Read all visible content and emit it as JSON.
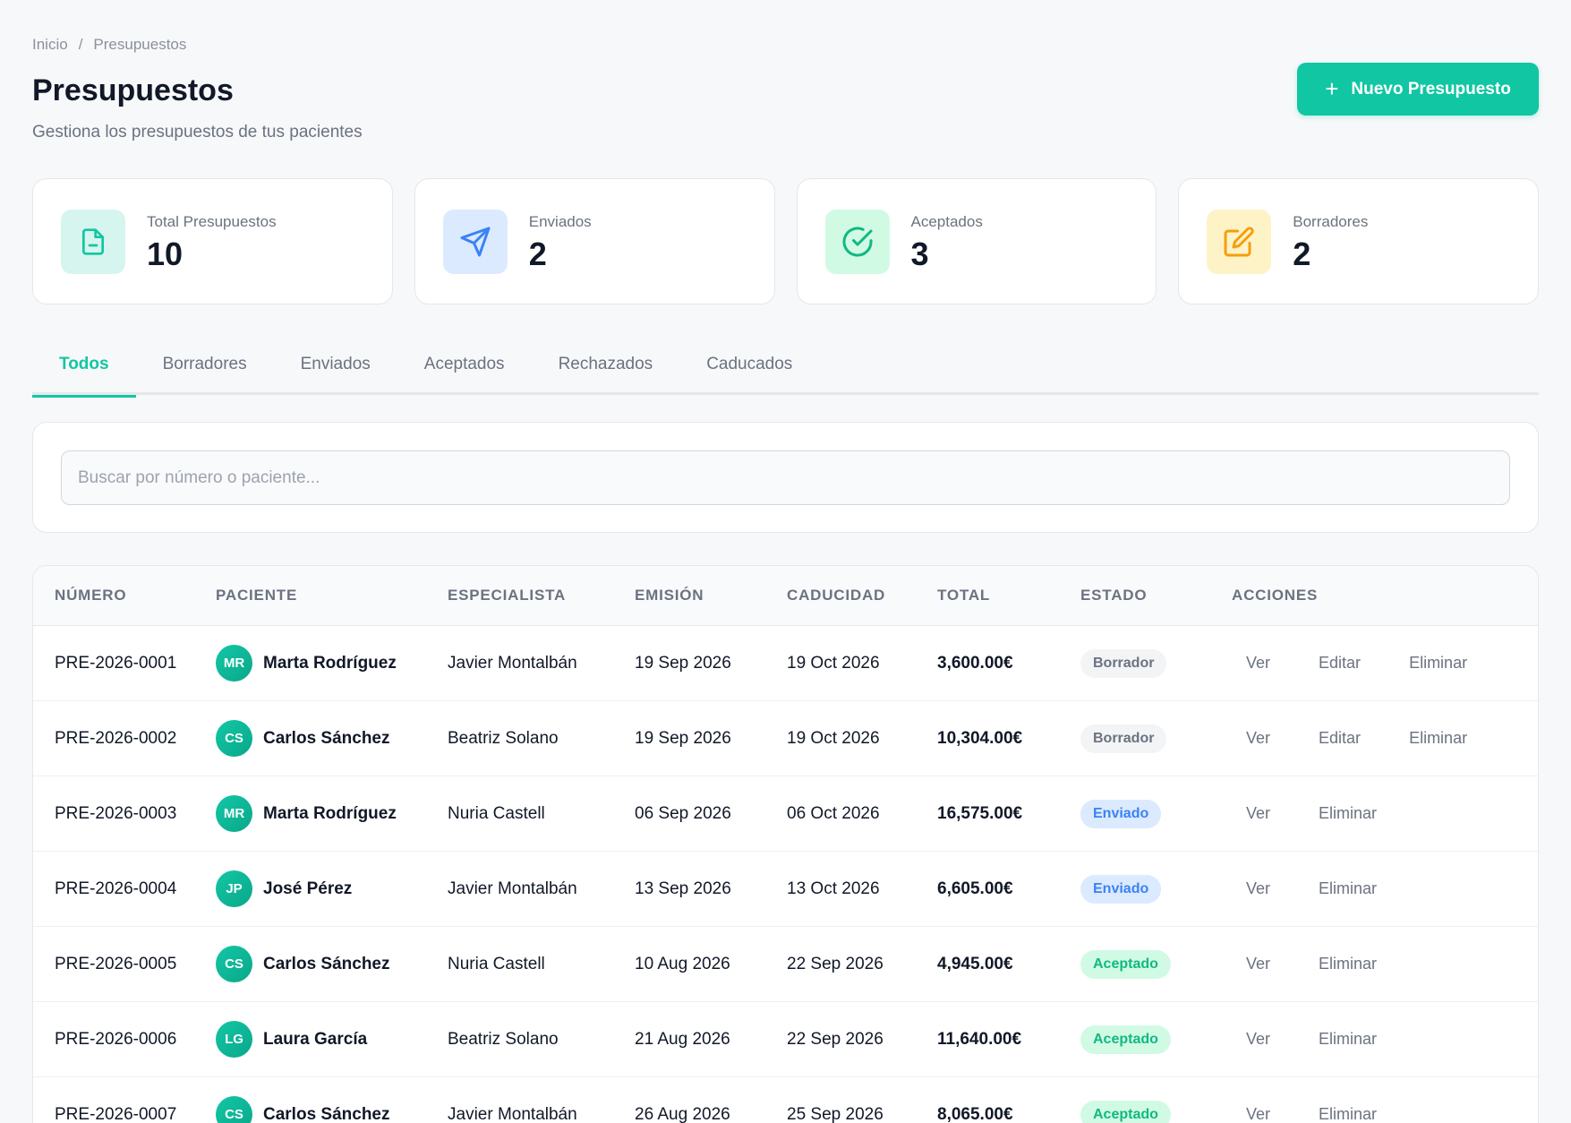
{
  "breadcrumb": {
    "home": "Inicio",
    "separator": "/",
    "current": "Presupuestos"
  },
  "header": {
    "title": "Presupuestos",
    "subtitle": "Gestiona los presupuestos de tus pacientes",
    "new_button": {
      "icon": "plus-icon",
      "label": "Nuevo Presupuesto"
    }
  },
  "stats": [
    {
      "label": "Total Presupuestos",
      "value": "10",
      "icon": "file-icon",
      "color": "#11c6a3",
      "bg": "#d5f5ee"
    },
    {
      "label": "Enviados",
      "value": "2",
      "icon": "send-icon",
      "color": "#3b82f6",
      "bg": "#dbeafe"
    },
    {
      "label": "Aceptados",
      "value": "3",
      "icon": "check-circle-icon",
      "color": "#10b981",
      "bg": "#d1fae5"
    },
    {
      "label": "Borradores",
      "value": "2",
      "icon": "edit-icon",
      "color": "#f59e0b",
      "bg": "#fef3c7"
    }
  ],
  "tabs": [
    {
      "label": "Todos",
      "active": true
    },
    {
      "label": "Borradores",
      "active": false
    },
    {
      "label": "Enviados",
      "active": false
    },
    {
      "label": "Aceptados",
      "active": false
    },
    {
      "label": "Rechazados",
      "active": false
    },
    {
      "label": "Caducados",
      "active": false
    }
  ],
  "search": {
    "placeholder": "Buscar por número o paciente...",
    "value": ""
  },
  "table": {
    "columns": [
      "NÚMERO",
      "PACIENTE",
      "ESPECIALISTA",
      "EMISIÓN",
      "CADUCIDAD",
      "TOTAL",
      "ESTADO",
      "ACCIONES"
    ],
    "rows": [
      {
        "numero": "PRE-2026-0001",
        "initials": "MR",
        "paciente": "Marta Rodríguez",
        "especialista": "Javier Montalbán",
        "emision": "19 Sep 2026",
        "caducidad": "19 Oct 2026",
        "total": "3,600.00€",
        "estado": "Borrador",
        "estado_key": "borrador",
        "acciones": [
          "Ver",
          "Editar",
          "Eliminar"
        ]
      },
      {
        "numero": "PRE-2026-0002",
        "initials": "CS",
        "paciente": "Carlos Sánchez",
        "especialista": "Beatriz Solano",
        "emision": "19 Sep 2026",
        "caducidad": "19 Oct 2026",
        "total": "10,304.00€",
        "estado": "Borrador",
        "estado_key": "borrador",
        "acciones": [
          "Ver",
          "Editar",
          "Eliminar"
        ]
      },
      {
        "numero": "PRE-2026-0003",
        "initials": "MR",
        "paciente": "Marta Rodríguez",
        "especialista": "Nuria Castell",
        "emision": "06 Sep 2026",
        "caducidad": "06 Oct 2026",
        "total": "16,575.00€",
        "estado": "Enviado",
        "estado_key": "enviado",
        "acciones": [
          "Ver",
          "Eliminar"
        ]
      },
      {
        "numero": "PRE-2026-0004",
        "initials": "JP",
        "paciente": "José Pérez",
        "especialista": "Javier Montalbán",
        "emision": "13 Sep 2026",
        "caducidad": "13 Oct 2026",
        "total": "6,605.00€",
        "estado": "Enviado",
        "estado_key": "enviado",
        "acciones": [
          "Ver",
          "Eliminar"
        ]
      },
      {
        "numero": "PRE-2026-0005",
        "initials": "CS",
        "paciente": "Carlos Sánchez",
        "especialista": "Nuria Castell",
        "emision": "10 Aug 2026",
        "caducidad": "22 Sep 2026",
        "total": "4,945.00€",
        "estado": "Aceptado",
        "estado_key": "aceptado",
        "acciones": [
          "Ver",
          "Eliminar"
        ]
      },
      {
        "numero": "PRE-2026-0006",
        "initials": "LG",
        "paciente": "Laura García",
        "especialista": "Beatriz Solano",
        "emision": "21 Aug 2026",
        "caducidad": "22 Sep 2026",
        "total": "11,640.00€",
        "estado": "Aceptado",
        "estado_key": "aceptado",
        "acciones": [
          "Ver",
          "Eliminar"
        ]
      },
      {
        "numero": "PRE-2026-0007",
        "initials": "CS",
        "paciente": "Carlos Sánchez",
        "especialista": "Javier Montalbán",
        "emision": "26 Aug 2026",
        "caducidad": "25 Sep 2026",
        "total": "8,065.00€",
        "estado": "Aceptado",
        "estado_key": "aceptado",
        "acciones": [
          "Ver",
          "Eliminar"
        ]
      }
    ]
  }
}
